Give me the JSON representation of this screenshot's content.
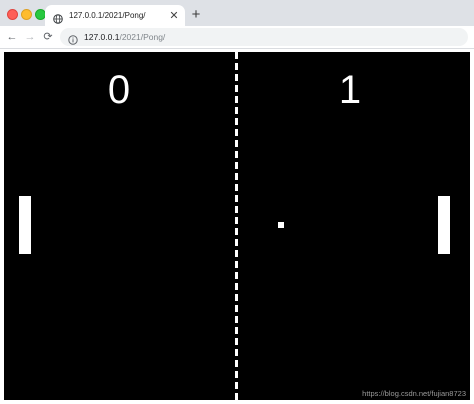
{
  "browser": {
    "tab": {
      "icon": "globe-icon",
      "title": "127.0.0.1/2021/Pong/",
      "close_icon": "close-icon"
    },
    "new_tab_icon": "plus-icon",
    "nav": {
      "back_icon": "arrow-left-icon",
      "forward_icon": "arrow-right-icon",
      "reload_icon": "reload-icon"
    },
    "omnibox": {
      "info_icon": "info-icon",
      "url_host": "127.0.0.1",
      "url_path": "/2021/Pong/"
    }
  },
  "game": {
    "background": "#000000",
    "foreground": "#ffffff",
    "score_left": "0",
    "score_right": "1",
    "watermark": "https://blog.csdn.net/fujian8723"
  }
}
